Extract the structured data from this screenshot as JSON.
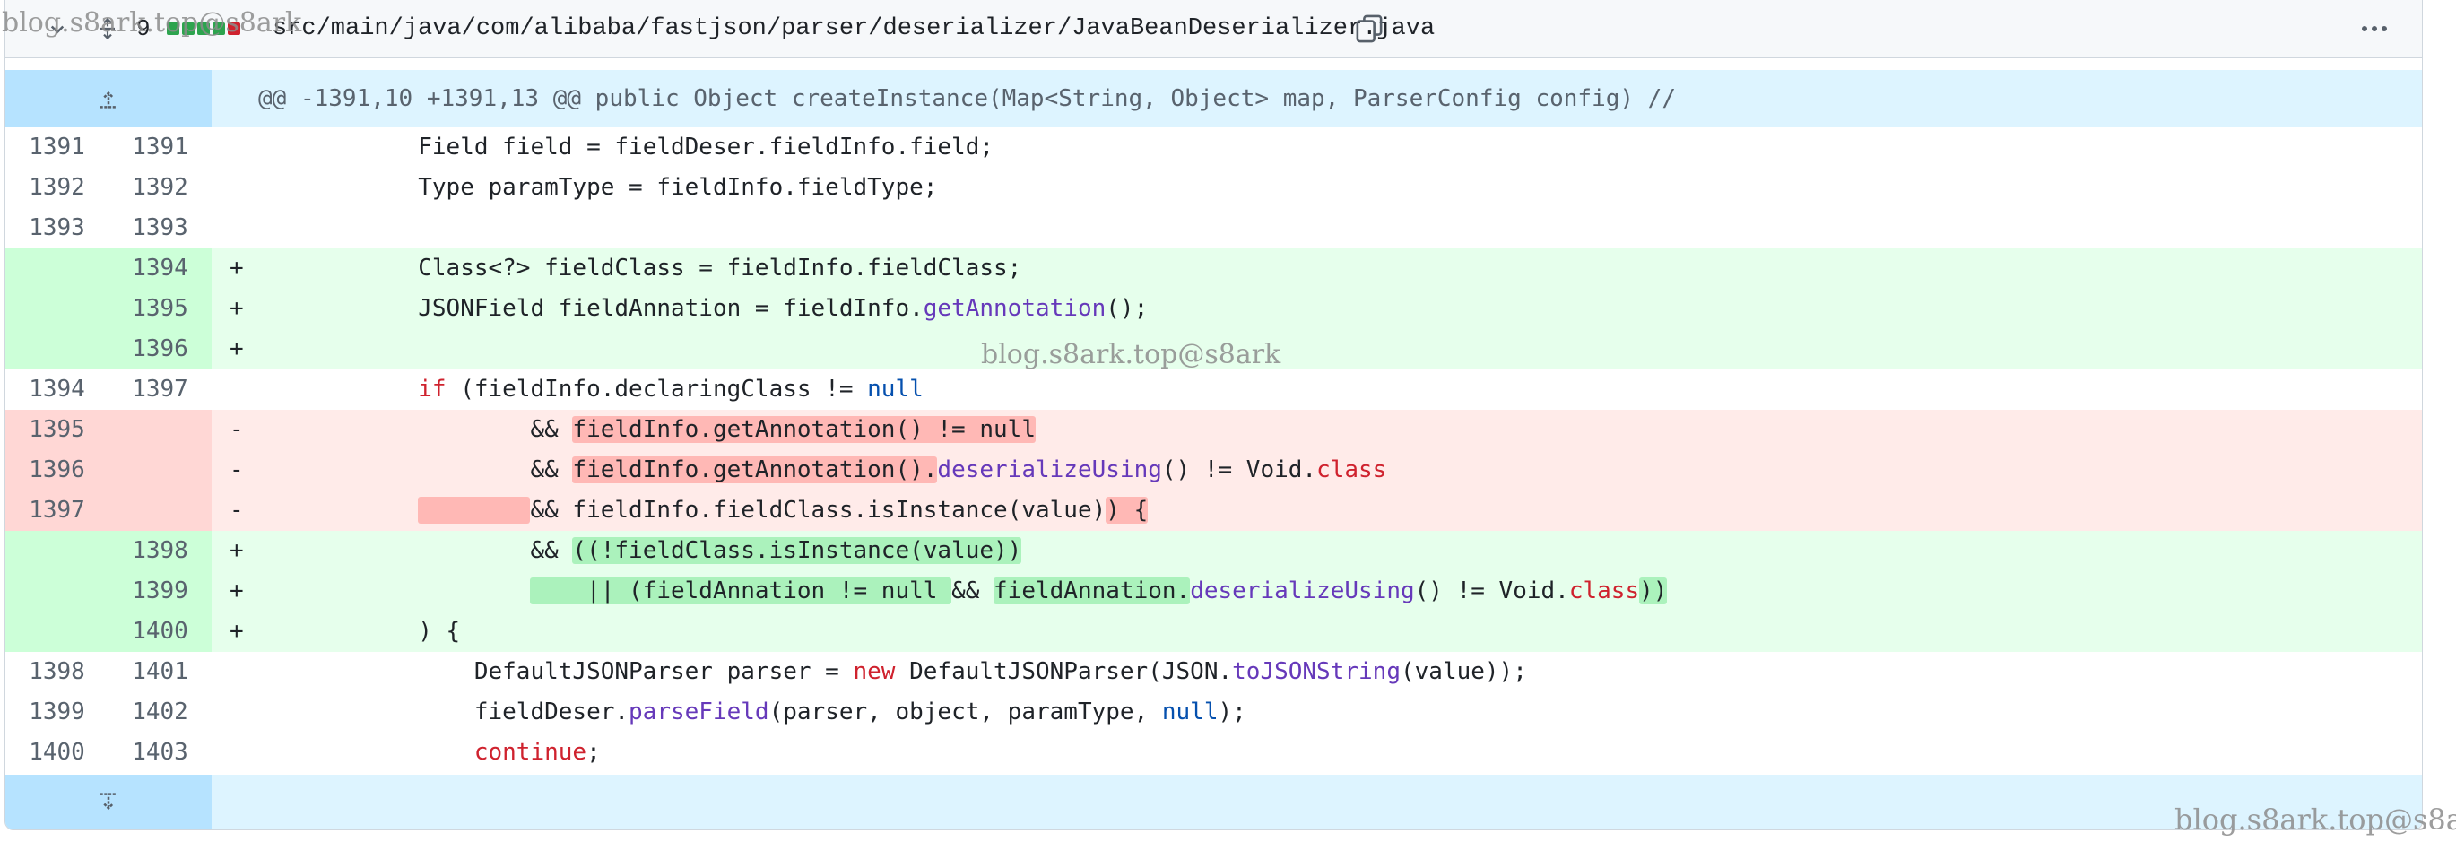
{
  "file": {
    "changes": "9",
    "path": "src/main/java/com/alibaba/fastjson/parser/deserializer/JavaBeanDeserializer.java"
  },
  "hunk": "@@ -1391,10 +1391,13 @@ public Object createInstance(Map<String, Object> map, ParserConfig config) //",
  "lines": [
    {
      "old": "1391",
      "new": "1391",
      "sign": ""
    },
    {
      "old": "1392",
      "new": "1392",
      "sign": ""
    },
    {
      "old": "1393",
      "new": "1393",
      "sign": ""
    },
    {
      "old": "",
      "new": "1394",
      "sign": "+"
    },
    {
      "old": "",
      "new": "1395",
      "sign": "+"
    },
    {
      "old": "",
      "new": "1396",
      "sign": "+"
    },
    {
      "old": "1394",
      "new": "1397",
      "sign": ""
    },
    {
      "old": "1395",
      "new": "",
      "sign": "-"
    },
    {
      "old": "1396",
      "new": "",
      "sign": "-"
    },
    {
      "old": "1397",
      "new": "",
      "sign": "-"
    },
    {
      "old": "",
      "new": "1398",
      "sign": "+"
    },
    {
      "old": "",
      "new": "1399",
      "sign": "+"
    },
    {
      "old": "",
      "new": "1400",
      "sign": "+"
    },
    {
      "old": "1398",
      "new": "1401",
      "sign": ""
    },
    {
      "old": "1399",
      "new": "1402",
      "sign": ""
    },
    {
      "old": "1400",
      "new": "1403",
      "sign": ""
    }
  ],
  "code": {
    "l0": "Field field = fieldDeser.fieldInfo.field;",
    "l1": "Type paramType = fieldInfo.fieldType;",
    "l3": "Class<?> fieldClass = fieldInfo.fieldClass;",
    "l4a": "JSONField fieldAnnation = fieldInfo.",
    "l4b": "getAnnotation",
    "l4c": "();",
    "l6a": "if",
    "l6b": " (fieldInfo.declaringClass != ",
    "l6c": "null",
    "l7a": "&& ",
    "l7b": "fieldInfo.getAnnotation() != null",
    "l8a": "&& ",
    "l8b": "fieldInfo.getAnnotation().",
    "l8c": "deserializeUsing",
    "l8d": "() != Void.",
    "l8e": "class",
    "l9a": "        ",
    "l9b": "&& fieldInfo.fieldClass.isInstance(value)",
    "l9c": ") {",
    "l10a": "&& ",
    "l10b": "((!fieldClass.isInstance(value))",
    "l11a": "    || (fieldAnnation != null ",
    "l11b": "&& ",
    "l11c": "fieldAnnation.",
    "l11d": "deserializeUsing",
    "l11e": "() != Void.",
    "l11f": "class",
    "l11g": "))",
    "l12": ") {",
    "l13a": "DefaultJSONParser parser = ",
    "l13b": "new",
    "l13c": " DefaultJSONParser(JSON.",
    "l13d": "toJSONString",
    "l13e": "(value));",
    "l14a": "fieldDeser.",
    "l14b": "parseField",
    "l14c": "(parser, object, paramType, ",
    "l14d": "null",
    "l14e": ");",
    "l15a": "continue",
    "l15b": ";"
  },
  "watermark": "blog.s8ark.top@s8ark",
  "icons": {
    "chevron": "chevron-down-icon",
    "expand_all": "unfold-icon",
    "copy": "copy-icon",
    "kebab": "kebab-horizontal-icon",
    "expand_up": "fold-up-icon",
    "expand_down": "fold-down-icon"
  },
  "colors": {
    "add_bg": "#e6ffec",
    "del_bg": "#ffebe9",
    "hunk_bg": "#ddf4ff",
    "keyword": "#cf222e",
    "function": "#6639ba",
    "literal": "#0550ae"
  }
}
